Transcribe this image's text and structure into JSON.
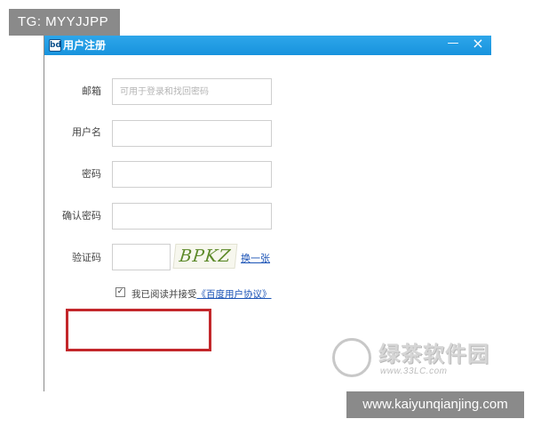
{
  "overlay": {
    "tg_label": "TG: MYYJJPP",
    "site_label": "www.kaiyunqianjing.com"
  },
  "window": {
    "app_icon": "bd-logo-icon",
    "icon_text": "bd",
    "title": "用户注册",
    "minimize_glyph": "—",
    "close_glyph": "×"
  },
  "form": {
    "email": {
      "label": "邮箱",
      "placeholder": "可用于登录和找回密码",
      "value": ""
    },
    "username": {
      "label": "用户名",
      "value": ""
    },
    "password": {
      "label": "密码",
      "value": ""
    },
    "confirm_password": {
      "label": "确认密码",
      "value": ""
    },
    "captcha": {
      "label": "验证码",
      "value": "",
      "image_text": "BPKZ",
      "refresh_link": "换一张"
    },
    "agreement": {
      "checked": true,
      "check_glyph": "✓",
      "text": "我已阅读并接受",
      "link": "《百度用户协议》"
    }
  },
  "watermark": {
    "title": "绿茶软件园",
    "url": "www.33LC.com"
  },
  "colors": {
    "titlebar": "#1e9be2",
    "highlight": "#c3272b",
    "link": "#1b53b6"
  }
}
